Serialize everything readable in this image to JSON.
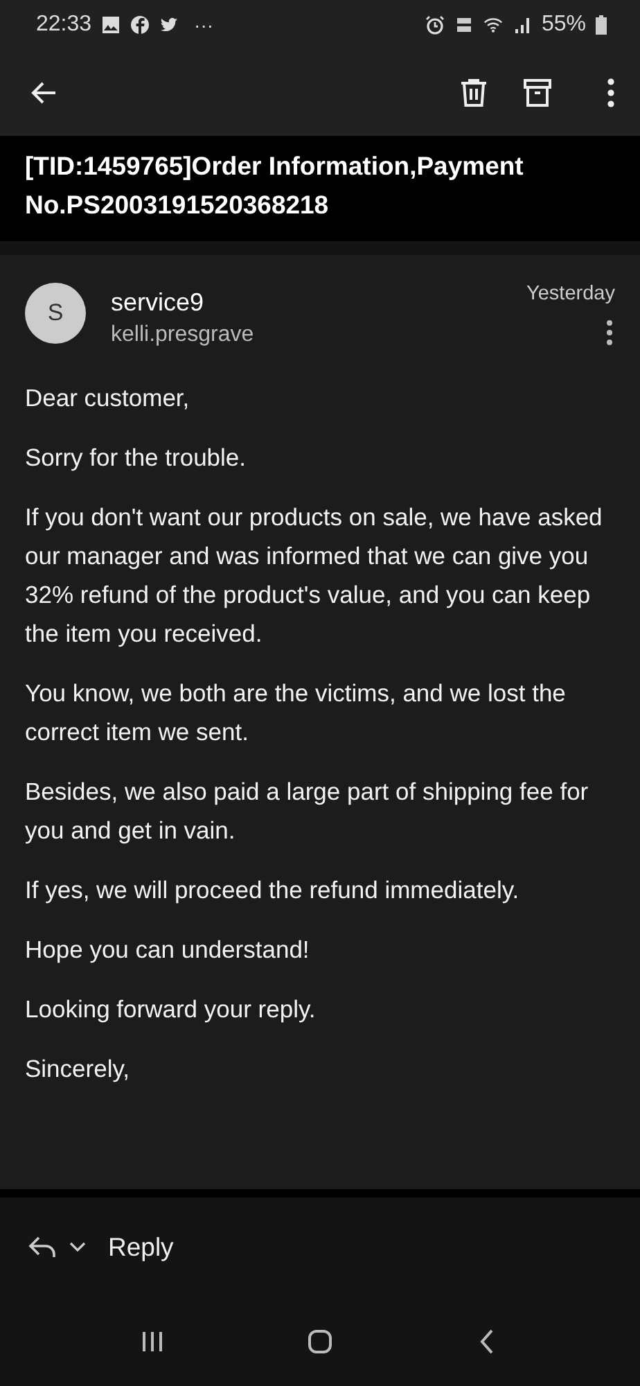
{
  "status_bar": {
    "time": "22:33",
    "more": "···",
    "battery": "55%"
  },
  "subject": "[TID:1459765]Order Information,Payment No.PS2003191520368218",
  "sender": {
    "initial": "S",
    "name": "service9",
    "address": "kelli.presgrave",
    "date": "Yesterday"
  },
  "body": [
    "Dear customer,",
    "Sorry for the trouble.",
    "If you don't want our products on sale, we have asked our manager and was informed that we can give you 32% refund of the product's value, and you can keep the item you received.",
    "You know, we both are the victims, and we lost the correct item we sent.",
    "Besides, we also paid a large part of shipping fee for you and get in vain.",
    "If yes, we will proceed the refund immediately.",
    "Hope you can understand!",
    "Looking forward your reply.",
    "Sincerely,"
  ],
  "reply": {
    "label": "Reply"
  }
}
